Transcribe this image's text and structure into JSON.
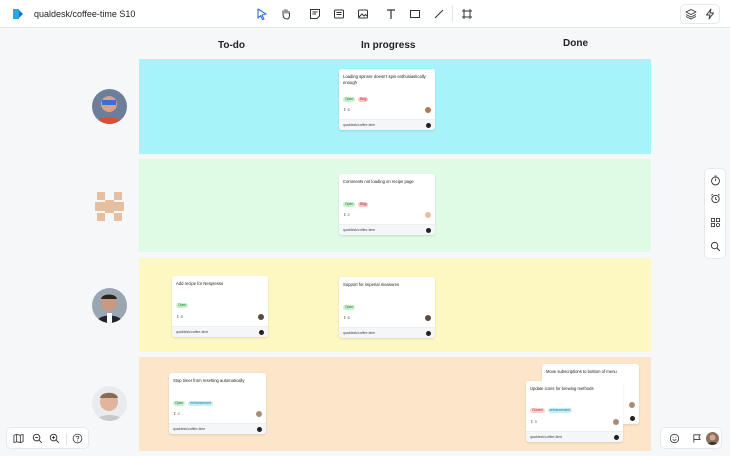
{
  "app": {
    "title": "qualdesk/coffee-time S10"
  },
  "toolbar": {
    "tools": [
      "select-icon",
      "hand-icon",
      "sticky-note-icon",
      "card-icon",
      "image-icon",
      "text-icon",
      "rectangle-icon",
      "line-icon",
      "frame-icon"
    ],
    "right": [
      "layers-icon",
      "lightning-icon"
    ]
  },
  "columns": [
    "To-do",
    "In progress",
    "Done"
  ],
  "lanes": [
    {
      "color": "#a6f3fa"
    },
    {
      "color": "#dffbe6"
    },
    {
      "color": "#fdf8c1"
    },
    {
      "color": "#fde5c9"
    }
  ],
  "cards": [
    {
      "title": "Loading spinner doesn't spin enthusiastically enough",
      "tags": [
        "Open",
        "Bug"
      ],
      "points": "6",
      "repo": "qualdesk/coffee-time"
    },
    {
      "title": "Comments not loading on recipe page",
      "tags": [
        "Open",
        "Bug"
      ],
      "points": "2",
      "repo": "qualdesk/coffee-time"
    },
    {
      "title": "Add recipe for Nespresso",
      "tags": [
        "Open"
      ],
      "points": "8",
      "repo": "qualdesk/coffee-time"
    },
    {
      "title": "Support for imperial measures",
      "tags": [
        "Open"
      ],
      "points": "6",
      "repo": "qualdesk/coffee-time"
    },
    {
      "title": "Stop timer from resetting automatically",
      "tags": [
        "Open",
        "enhancement"
      ],
      "points": "2",
      "repo": "qualdesk/coffee-time"
    },
    {
      "title": "Move subscriptions to bottom of menu",
      "tags": [],
      "points": "",
      "repo": ""
    },
    {
      "title": "Update icons for brewing methods",
      "tags": [
        "Closed",
        "enhancement"
      ],
      "points": "3",
      "repo": "qualdesk/coffee-time"
    }
  ],
  "right_sidebar": [
    "timer-icon",
    "alarm-icon",
    "apps-icon",
    "search-icon"
  ],
  "bottom_left": [
    "map-icon",
    "zoom-out-icon",
    "zoom-in-icon",
    "help-icon"
  ],
  "bottom_right": [
    "emoji-icon",
    "present-icon",
    "user-avatar"
  ]
}
